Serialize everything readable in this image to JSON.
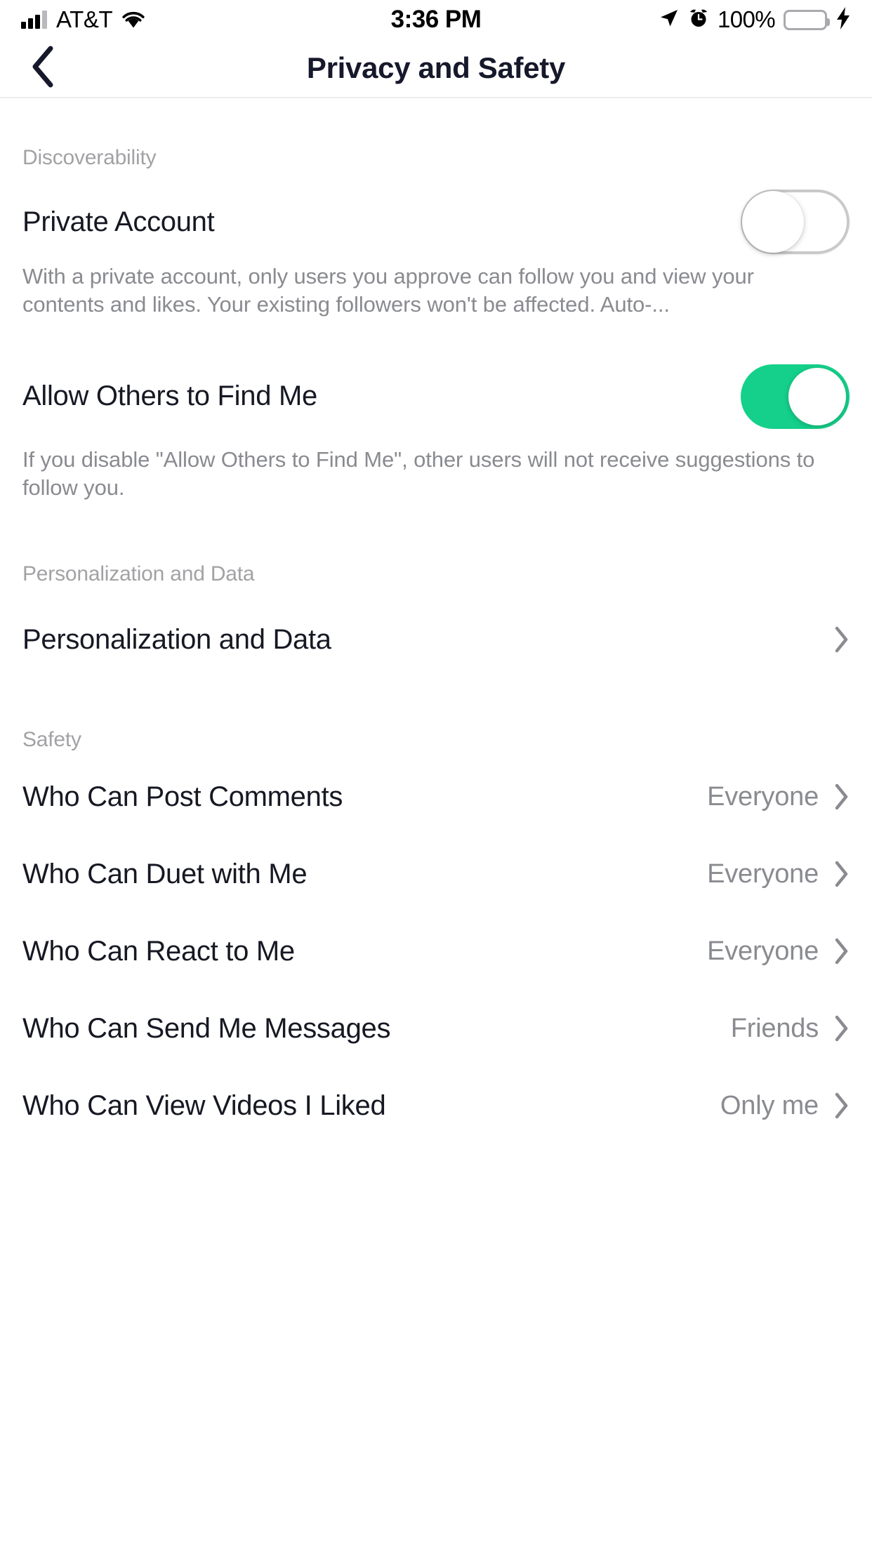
{
  "status_bar": {
    "carrier": "AT&T",
    "time": "3:36 PM",
    "battery_percent": "100%",
    "icons": {
      "signal": "signal-bars-icon",
      "wifi": "wifi-icon",
      "location": "location-arrow-icon",
      "alarm": "alarm-clock-icon",
      "battery": "battery-icon",
      "charging": "lightning-bolt-icon"
    },
    "battery_color": "#3fd763"
  },
  "navbar": {
    "back": "back-chevron-icon",
    "title": "Privacy and Safety"
  },
  "theme": {
    "accent_green": "#14d08a",
    "text_primary": "#161823",
    "text_secondary": "#8a8b90",
    "section_header": "#a2a2a5",
    "divider": "#ececec"
  },
  "sections": [
    {
      "header": "Discoverability",
      "rows": [
        {
          "label": "Private Account",
          "type": "toggle",
          "value": "off",
          "description": "With a private account, only users you approve can follow you and view your contents and likes. Your existing followers won't be affected. Auto-..."
        },
        {
          "label": "Allow Others to Find Me",
          "type": "toggle",
          "value": "on",
          "description": "If you disable \"Allow Others to Find Me\", other users will not receive suggestions to follow you."
        }
      ]
    },
    {
      "header": "Personalization and Data",
      "rows": [
        {
          "label": "Personalization and Data",
          "type": "link",
          "value": ""
        }
      ]
    },
    {
      "header": "Safety",
      "rows": [
        {
          "label": "Who Can Post Comments",
          "type": "link",
          "value": "Everyone"
        },
        {
          "label": "Who Can Duet with Me",
          "type": "link",
          "value": "Everyone"
        },
        {
          "label": "Who Can React to Me",
          "type": "link",
          "value": "Everyone"
        },
        {
          "label": "Who Can Send Me Messages",
          "type": "link",
          "value": "Friends"
        },
        {
          "label": "Who Can View Videos I Liked",
          "type": "link",
          "value": "Only me"
        }
      ]
    }
  ]
}
